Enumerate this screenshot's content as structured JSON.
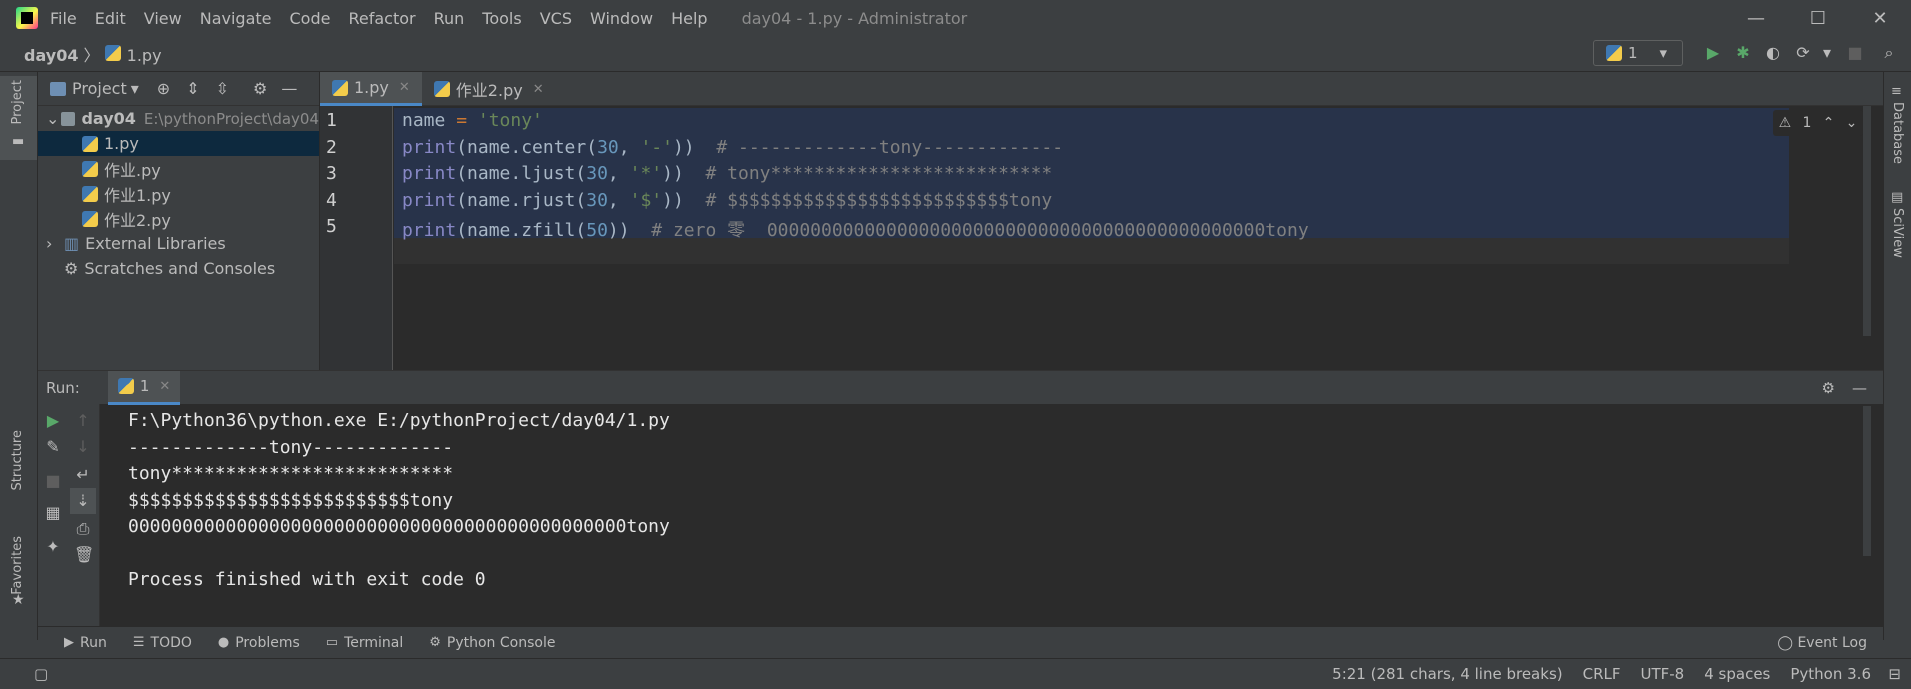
{
  "menubar": {
    "items": [
      "File",
      "Edit",
      "View",
      "Navigate",
      "Code",
      "Refactor",
      "Run",
      "Tools",
      "VCS",
      "Window",
      "Help"
    ],
    "window_title": "day04 - 1.py - Administrator"
  },
  "navbar": {
    "project": "day04",
    "file": "1.py",
    "run_config": "1"
  },
  "left_strip": {
    "project_tab": "Project",
    "structure_tab": "Structure",
    "favorites_tab": "Favorites"
  },
  "right_strip": {
    "database_tab": "Database",
    "sciview_tab": "SciView"
  },
  "project": {
    "title": "Project",
    "root": "day04",
    "root_path": "E:\\pythonProject\\day04",
    "files": [
      "1.py",
      "作业.py",
      "作业1.py",
      "作业2.py"
    ],
    "external": "External Libraries",
    "scratches": "Scratches and Consoles"
  },
  "editor": {
    "tabs": [
      "1.py",
      "作业2.py"
    ],
    "warning_count": "1",
    "line_numbers": [
      "1",
      "2",
      "3",
      "4",
      "5"
    ],
    "lines": [
      [
        {
          "t": "name ",
          "c": ""
        },
        {
          "t": "=",
          "c": "o"
        },
        {
          "t": " 'tony'",
          "c": "s"
        }
      ],
      [
        {
          "t": "print",
          "c": "k"
        },
        {
          "t": "(name.center(",
          "c": ""
        },
        {
          "t": "30",
          "c": "n"
        },
        {
          "t": ", ",
          "c": ""
        },
        {
          "t": "'-'",
          "c": "s"
        },
        {
          "t": "))  ",
          "c": ""
        },
        {
          "t": "# -------------tony-------------",
          "c": "c"
        }
      ],
      [
        {
          "t": "print",
          "c": "k"
        },
        {
          "t": "(name.ljust(",
          "c": ""
        },
        {
          "t": "30",
          "c": "n"
        },
        {
          "t": ", ",
          "c": ""
        },
        {
          "t": "'*'",
          "c": "s"
        },
        {
          "t": "))  ",
          "c": ""
        },
        {
          "t": "# tony**************************",
          "c": "c"
        }
      ],
      [
        {
          "t": "print",
          "c": "k"
        },
        {
          "t": "(name.rjust(",
          "c": ""
        },
        {
          "t": "30",
          "c": "n"
        },
        {
          "t": ", ",
          "c": ""
        },
        {
          "t": "'$'",
          "c": "s"
        },
        {
          "t": "))  ",
          "c": ""
        },
        {
          "t": "# $$$$$$$$$$$$$$$$$$$$$$$$$$tony",
          "c": "c"
        }
      ],
      [
        {
          "t": "print",
          "c": "k"
        },
        {
          "t": "(name.zfill(",
          "c": ""
        },
        {
          "t": "50",
          "c": "n"
        },
        {
          "t": "))  ",
          "c": ""
        },
        {
          "t": "# zero 零  0000000000000000000000000000000000000000000000tony",
          "c": "c"
        }
      ]
    ]
  },
  "run": {
    "label": "Run:",
    "tab": "1",
    "output": [
      "F:\\Python36\\python.exe E:/pythonProject/day04/1.py",
      "-------------tony-------------",
      "tony**************************",
      "$$$$$$$$$$$$$$$$$$$$$$$$$$tony",
      "0000000000000000000000000000000000000000000000tony",
      "",
      "Process finished with exit code 0"
    ]
  },
  "bottom_tabs": [
    "Run",
    "TODO",
    "Problems",
    "Terminal",
    "Python Console"
  ],
  "event_log": "Event Log",
  "status": {
    "position": "5:21 (281 chars, 4 line breaks)",
    "line_sep": "CRLF",
    "encoding": "UTF-8",
    "indent": "4 spaces",
    "interpreter": "Python 3.6"
  }
}
